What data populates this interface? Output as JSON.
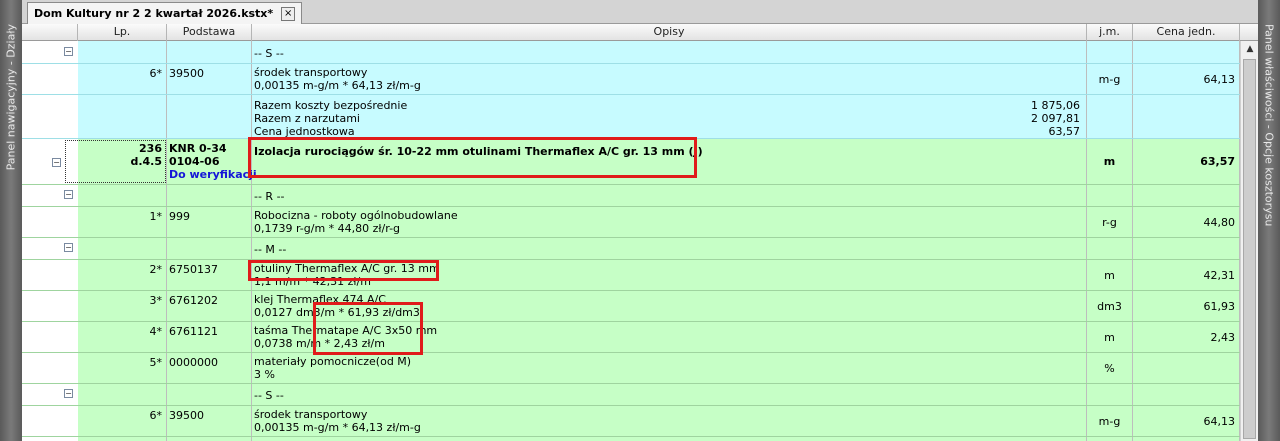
{
  "left_panel": {
    "label": "Panel nawigacyjny - Działy"
  },
  "right_panel": {
    "label": "Panel właściwości - Opcje kosztorysu"
  },
  "tab": {
    "title": "Dom Kultury nr 2 2 kwartał 2026.kstx*",
    "close": "×"
  },
  "columns": {
    "lp": "Lp.",
    "podstawa": "Podstawa",
    "opisy": "Opisy",
    "jm": "j.m.",
    "cena": "Cena jedn."
  },
  "rows": {
    "r1": {
      "label": "-- S --",
      "toggle": "−"
    },
    "r2": {
      "lp": "6*",
      "podstawa": "39500",
      "line1": "środek transportowy",
      "line2": "0,00135 m-g/m * 64,13 zł/m-g",
      "jm": "m-g",
      "cena": "64,13"
    },
    "r3": {
      "l1": "Razem koszty bezpośrednie",
      "v1": "1 875,06",
      "l2": "Razem z narzutami",
      "v2": "2 097,81",
      "l3": "Cena jednostkowa",
      "v3": "63,57"
    },
    "r4": {
      "lp1": "236",
      "lp2": "d.4.5",
      "pod1": "KNR 0-34",
      "pod2": "0104-06",
      "pod3": "Do weryfikacji",
      "opis": "Izolacja rurociągów śr. 10-22 mm otulinami Thermaflex A/C gr. 13 mm (J)",
      "jm": "m",
      "cena": "63,57",
      "toggle": "−"
    },
    "r5": {
      "label": "-- R --",
      "toggle": "−"
    },
    "r6": {
      "lp": "1*",
      "podstawa": "999",
      "line1": "Robocizna - roboty ogólnobudowlane",
      "line2": "0,1739 r-g/m * 44,80 zł/r-g",
      "jm": "r-g",
      "cena": "44,80"
    },
    "r7": {
      "label": "-- M --",
      "toggle": "−"
    },
    "r8": {
      "lp": "2*",
      "podstawa": "6750137",
      "line1": "otuliny Thermaflex A/C gr. 13 mm",
      "line2": "1,1 m/m * 42,31 zł/m",
      "jm": "m",
      "cena": "42,31"
    },
    "r9": {
      "lp": "3*",
      "podstawa": "6761202",
      "line1": "klej Thermaflex 474 A/C",
      "line2": "0,0127 dm3/m * 61,93 zł/dm3",
      "jm": "dm3",
      "cena": "61,93"
    },
    "r10": {
      "lp": "4*",
      "podstawa": "6761121",
      "line1": "taśma Thermatape A/C 3x50 mm",
      "line2": "0,0738 m/m * 2,43 zł/m",
      "jm": "m",
      "cena": "2,43"
    },
    "r11": {
      "lp": "5*",
      "podstawa": "0000000",
      "line1": "materiały pomocnicze(od M)",
      "line2": "3 %",
      "jm": "%",
      "cena": ""
    },
    "r12": {
      "label": "-- S --",
      "toggle": "−"
    },
    "r13": {
      "lp": "6*",
      "podstawa": "39500",
      "line1": "środek transportowy",
      "line2": "0,00135 m-g/m * 64,13 zł/m-g",
      "jm": "m-g",
      "cena": "64,13"
    }
  },
  "scroll": {
    "up": "▲"
  }
}
